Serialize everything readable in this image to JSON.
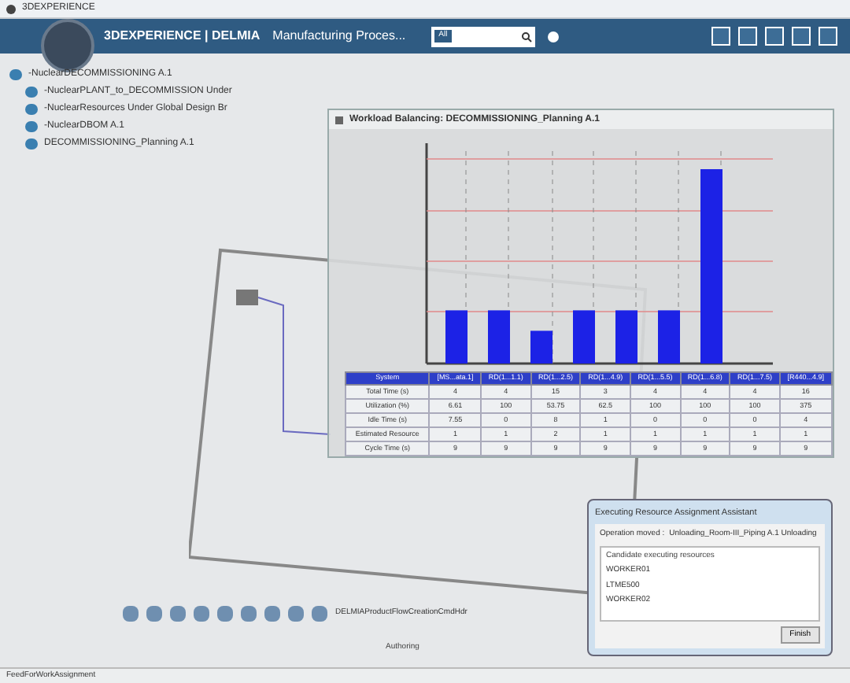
{
  "window": {
    "title": "3DEXPERIENCE"
  },
  "header": {
    "brand": "3DEXPERIENCE | DELMIA",
    "app": "Manufacturing Proces...",
    "search_scope": "All"
  },
  "tree": {
    "items": [
      {
        "label": "-NuclearDECOMMISSIONING A.1",
        "children": [
          {
            "label": "-NuclearPLANT_to_DECOMMISSION Under"
          },
          {
            "label": "-NuclearResources Under Global Design Br"
          },
          {
            "label": "-NuclearDBOM A.1"
          },
          {
            "label": "DECOMMISSIONING_Planning A.1"
          }
        ]
      }
    ]
  },
  "workload": {
    "title": "Workload Balancing: DECOMMISSIONING_Planning A.1",
    "columns": [
      "System",
      "[MS...ata.1]",
      "RD(1...1.1)",
      "RD(1...2.5)",
      "RD(1...4.9)",
      "RD(1...5.5)",
      "RD(1...6.8)",
      "RD(1...7.5)",
      "[R440...4.9]"
    ],
    "rows": [
      [
        "Total Time (s)",
        "4",
        "4",
        "15",
        "3",
        "4",
        "4",
        "4",
        "16"
      ],
      [
        "Utilization (%)",
        "6.61",
        "100",
        "53.75",
        "62.5",
        "100",
        "100",
        "100",
        "375"
      ],
      [
        "Idle Time (s)",
        "7.55",
        "0",
        "8",
        "1",
        "0",
        "0",
        "0",
        "4"
      ],
      [
        "Estimated Resource",
        "1",
        "1",
        "2",
        "1",
        "1",
        "1",
        "1",
        "1"
      ],
      [
        "Cycle Time (s)",
        "9",
        "9",
        "9",
        "9",
        "9",
        "9",
        "9",
        "9"
      ]
    ]
  },
  "assistant": {
    "title": "Executing Resource Assignment Assistant",
    "operation_label": "Operation moved :",
    "operation_value": "Unloading_Room-III_Piping A.1 Unloading",
    "list_header": "Candidate executing resources",
    "resources": [
      "WORKER01",
      "LTME500",
      "WORKER02"
    ],
    "button": "Finish"
  },
  "toolbar": {
    "command": "DELMIAProductFlowCreationCmdHdr",
    "section": "Authoring"
  },
  "status_bar": "FeedForWorkAssignment"
}
